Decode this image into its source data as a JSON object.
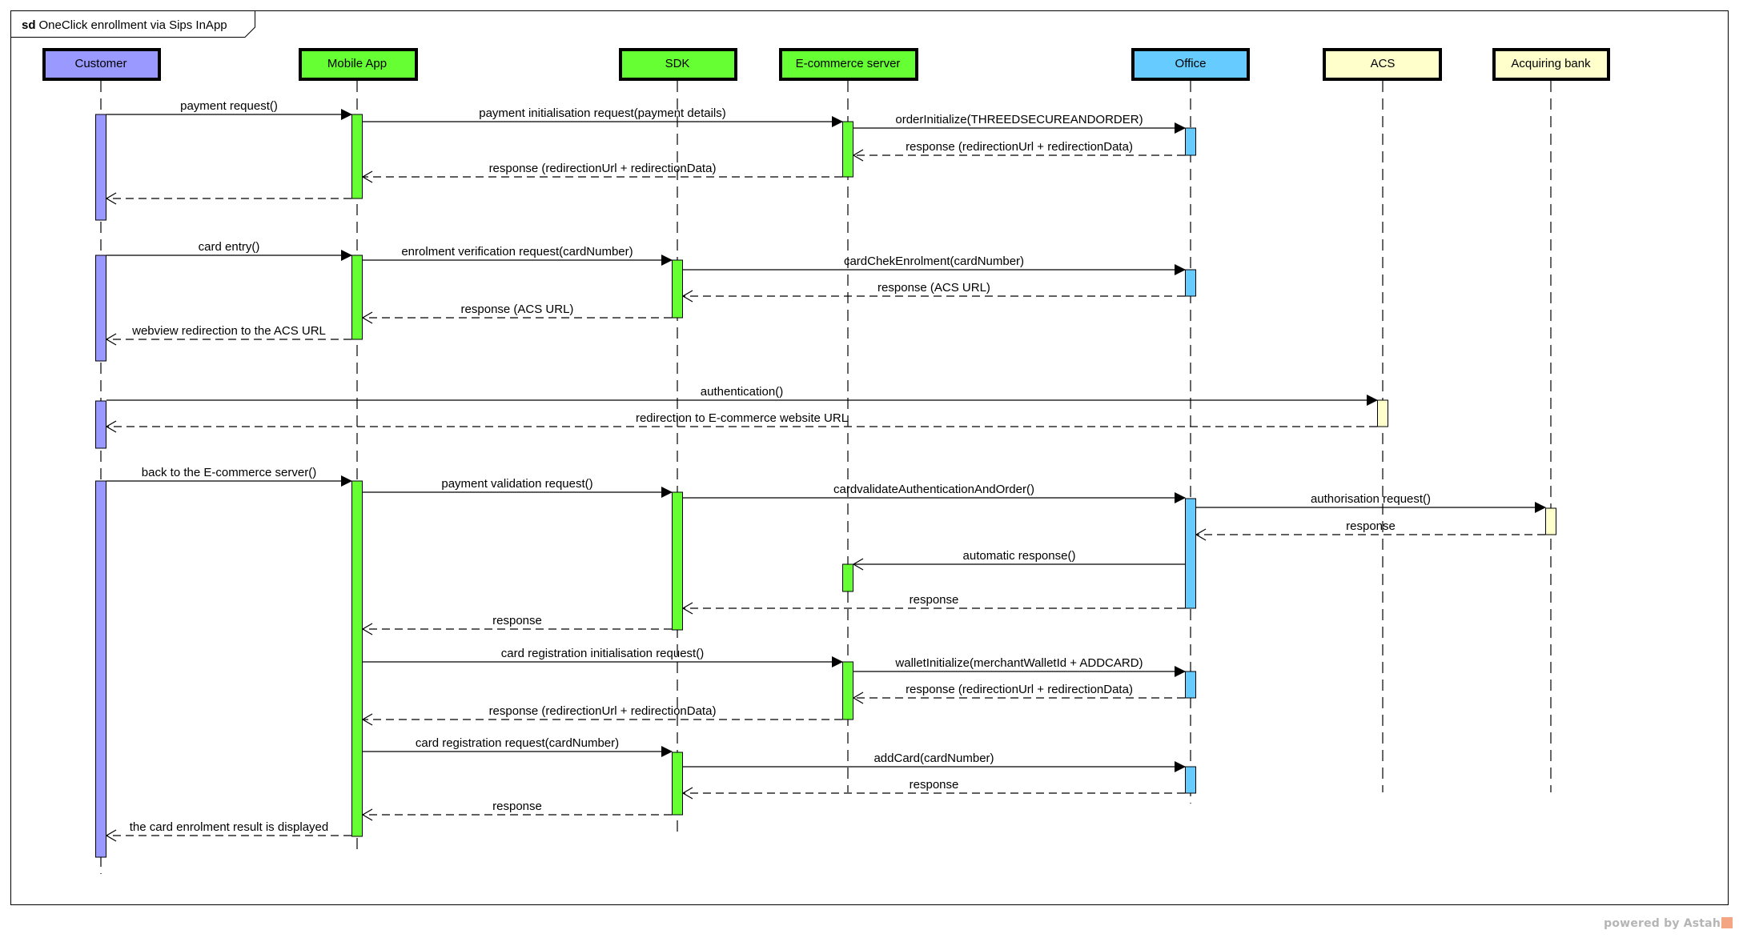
{
  "diagram": {
    "kind": "sd",
    "title": "OneClick enrollment via Sips InApp"
  },
  "lifelines": [
    {
      "id": "customer",
      "label": "Customer",
      "color": "#9999ff"
    },
    {
      "id": "mobile",
      "label": "Mobile App",
      "color": "#66ff33"
    },
    {
      "id": "sdk",
      "label": "SDK",
      "color": "#66ff33"
    },
    {
      "id": "ecom",
      "label": "E-commerce server",
      "color": "#66ff33"
    },
    {
      "id": "office",
      "label": "Office",
      "color": "#66ccff"
    },
    {
      "id": "acs",
      "label": "ACS",
      "color": "#ffffcc"
    },
    {
      "id": "bank",
      "label": "Acquiring bank",
      "color": "#ffffcc"
    }
  ],
  "messages": [
    {
      "from": "customer",
      "to": "mobile",
      "kind": "sync",
      "label": "payment request()"
    },
    {
      "from": "mobile",
      "to": "ecom",
      "kind": "sync",
      "label": "payment initialisation request(payment details)"
    },
    {
      "from": "ecom",
      "to": "office",
      "kind": "sync",
      "label": "orderInitialize(THREEDSECUREANDORDER)"
    },
    {
      "from": "office",
      "to": "ecom",
      "kind": "reply",
      "label": "response (redirectionUrl + redirectionData)"
    },
    {
      "from": "ecom",
      "to": "mobile",
      "kind": "reply",
      "label": "response (redirectionUrl + redirectionData)"
    },
    {
      "from": "mobile",
      "to": "customer",
      "kind": "reply",
      "label": ""
    },
    {
      "from": "customer",
      "to": "mobile",
      "kind": "sync",
      "label": "card entry()"
    },
    {
      "from": "mobile",
      "to": "sdk",
      "kind": "sync",
      "label": "enrolment verification request(cardNumber)"
    },
    {
      "from": "sdk",
      "to": "office",
      "kind": "sync",
      "label": "cardChekEnrolment(cardNumber)"
    },
    {
      "from": "office",
      "to": "sdk",
      "kind": "reply",
      "label": "response (ACS URL)"
    },
    {
      "from": "sdk",
      "to": "mobile",
      "kind": "reply",
      "label": "response (ACS URL)"
    },
    {
      "from": "mobile",
      "to": "customer",
      "kind": "reply",
      "label": "webview redirection to the ACS URL"
    },
    {
      "from": "customer",
      "to": "acs",
      "kind": "sync",
      "label": "authentication()"
    },
    {
      "from": "acs",
      "to": "customer",
      "kind": "reply",
      "label": "redirection to E-commerce website URL"
    },
    {
      "from": "customer",
      "to": "mobile",
      "kind": "sync",
      "label": "back to the E-commerce server()"
    },
    {
      "from": "mobile",
      "to": "sdk",
      "kind": "sync",
      "label": "payment validation request()"
    },
    {
      "from": "sdk",
      "to": "office",
      "kind": "sync",
      "label": "cardvalidateAuthenticationAndOrder()"
    },
    {
      "from": "office",
      "to": "bank",
      "kind": "sync",
      "label": "authorisation request()"
    },
    {
      "from": "bank",
      "to": "office",
      "kind": "reply",
      "label": "response"
    },
    {
      "from": "office",
      "to": "ecom",
      "kind": "async",
      "label": "automatic response()"
    },
    {
      "from": "office",
      "to": "sdk",
      "kind": "reply",
      "label": "response"
    },
    {
      "from": "sdk",
      "to": "mobile",
      "kind": "reply",
      "label": "response"
    },
    {
      "from": "mobile",
      "to": "ecom",
      "kind": "sync",
      "label": "card registration initialisation request()"
    },
    {
      "from": "ecom",
      "to": "office",
      "kind": "sync",
      "label": "walletInitialize(merchantWalletId + ADDCARD)"
    },
    {
      "from": "office",
      "to": "ecom",
      "kind": "reply",
      "label": "response (redirectionUrl + redirectionData)"
    },
    {
      "from": "ecom",
      "to": "mobile",
      "kind": "reply",
      "label": "response (redirectionUrl + redirectionData)"
    },
    {
      "from": "mobile",
      "to": "sdk",
      "kind": "sync",
      "label": "card registration request(cardNumber)"
    },
    {
      "from": "sdk",
      "to": "office",
      "kind": "sync",
      "label": "addCard(cardNumber)"
    },
    {
      "from": "office",
      "to": "sdk",
      "kind": "reply",
      "label": "response"
    },
    {
      "from": "sdk",
      "to": "mobile",
      "kind": "reply",
      "label": "response"
    },
    {
      "from": "mobile",
      "to": "customer",
      "kind": "reply",
      "label": "the card enrolment result is displayed"
    }
  ],
  "footer": {
    "watermark": "powered by Astah"
  }
}
